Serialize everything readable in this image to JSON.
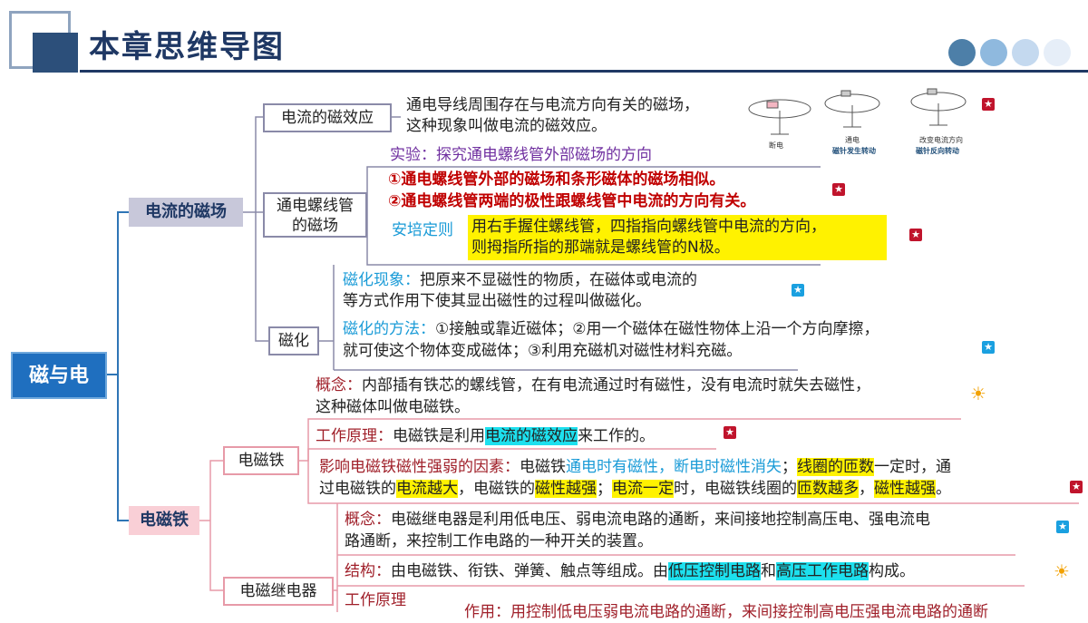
{
  "header": {
    "title": "本章思维导图"
  },
  "root": {
    "label": "磁与电"
  },
  "branches": {
    "current_magnetic": {
      "label": "电流的磁场"
    },
    "electromagnet": {
      "label": "电磁铁"
    }
  },
  "nodes": {
    "magnetic_effect": {
      "label": "电流的磁效应",
      "text_1": "通电导线周围存在与电流方向有关的磁场，",
      "text_2": "这种现象叫做电流的磁效应。",
      "figure_captions": [
        "断电",
        "通电",
        "磁针发生转动",
        "改变电流方向",
        "磁针反向转动"
      ]
    },
    "solenoid": {
      "label_1": "通电螺线管",
      "label_2": "的磁场",
      "experiment": "实验：探究通电螺线管外部磁场的方向",
      "conclusion_1": "①通电螺线管外部的磁场和条形磁体的磁场相似。",
      "conclusion_2": "②通电螺线管两端的极性跟螺线管中电流的方向有关。",
      "ampere_label": "安培定则",
      "ampere_1": "用右手握住螺线管，四指指向螺线管中电流的方向，",
      "ampere_2": "则拇指所指的那端就是螺线管的N极。"
    },
    "magnetization": {
      "label": "磁化",
      "phenomenon_label": "磁化现象：",
      "phenomenon_1": "把原来不显磁性的物质，在磁体或电流的",
      "phenomenon_2": "等方式作用下使其显出磁性的过程叫做磁化。",
      "method_label": "磁化的方法：",
      "method_1": "①接触或靠近磁体；②用一个磁体在磁性物体上沿一个方向摩擦，",
      "method_2": "就可使这个物体变成磁体；③利用充磁机对磁性材料充磁。"
    },
    "em_magnet": {
      "label": "电磁铁",
      "concept_label": "概念：",
      "concept_1": "内部插有铁芯的螺线管，在有电流通过时有磁性，没有电流时就失去磁性，",
      "concept_2": "这种磁体叫做电磁铁。",
      "principle_label": "工作原理：",
      "principle_a": "电磁铁是利用",
      "principle_hl": "电流的磁效应",
      "principle_b": "来工作的。",
      "factors_label": "影响电磁铁磁性强弱的因素：",
      "factors_a": "电磁铁",
      "factors_b": "通电时有磁性，断电时磁性消失",
      "factors_c": "；",
      "factors_d": "线圈的匝数",
      "factors_e": "一定时，通",
      "factors_f": "过电磁铁的",
      "factors_g": "电流越大",
      "factors_h": "，电磁铁的",
      "factors_i": "磁性越强",
      "factors_j": "；",
      "factors_k": "电流一定",
      "factors_l": "时，电磁铁线圈的",
      "factors_m": "匝数越多",
      "factors_n": "，",
      "factors_o": "磁性越强",
      "factors_p": "。"
    },
    "relay": {
      "label": "电磁继电器",
      "concept_label": "概念：",
      "concept_1": "电磁继电器是利用低电压、弱电流电路的通断，来间接地控制高压电、强电流电",
      "concept_2": "路通断，来控制工作电路的一种开关的装置。",
      "structure_label": "结构：",
      "structure_a": "由电磁铁、衔铁、弹簧、触点等组成。由",
      "structure_hl1": "低压控制电路",
      "structure_b": "和",
      "structure_hl2": "高压工作电路",
      "structure_c": "构成。",
      "principle_label": "工作原理",
      "function_partial": "作用：用控制低电压弱电流电路的通断，来间接控制高电压强电流电路的通断"
    }
  },
  "colors": {
    "title_blue": "#1f3864",
    "root_bg": "#1f6fbf",
    "branch1_bg": "#c8c8da",
    "branch2_bg": "#f9cfd6",
    "line_blue": "#2e75b6",
    "highlight_yellow": "#fff200",
    "highlight_cyan": "#1de0ee"
  },
  "icons": [
    "red-star-icon",
    "blue-star-icon",
    "sun-icon"
  ]
}
